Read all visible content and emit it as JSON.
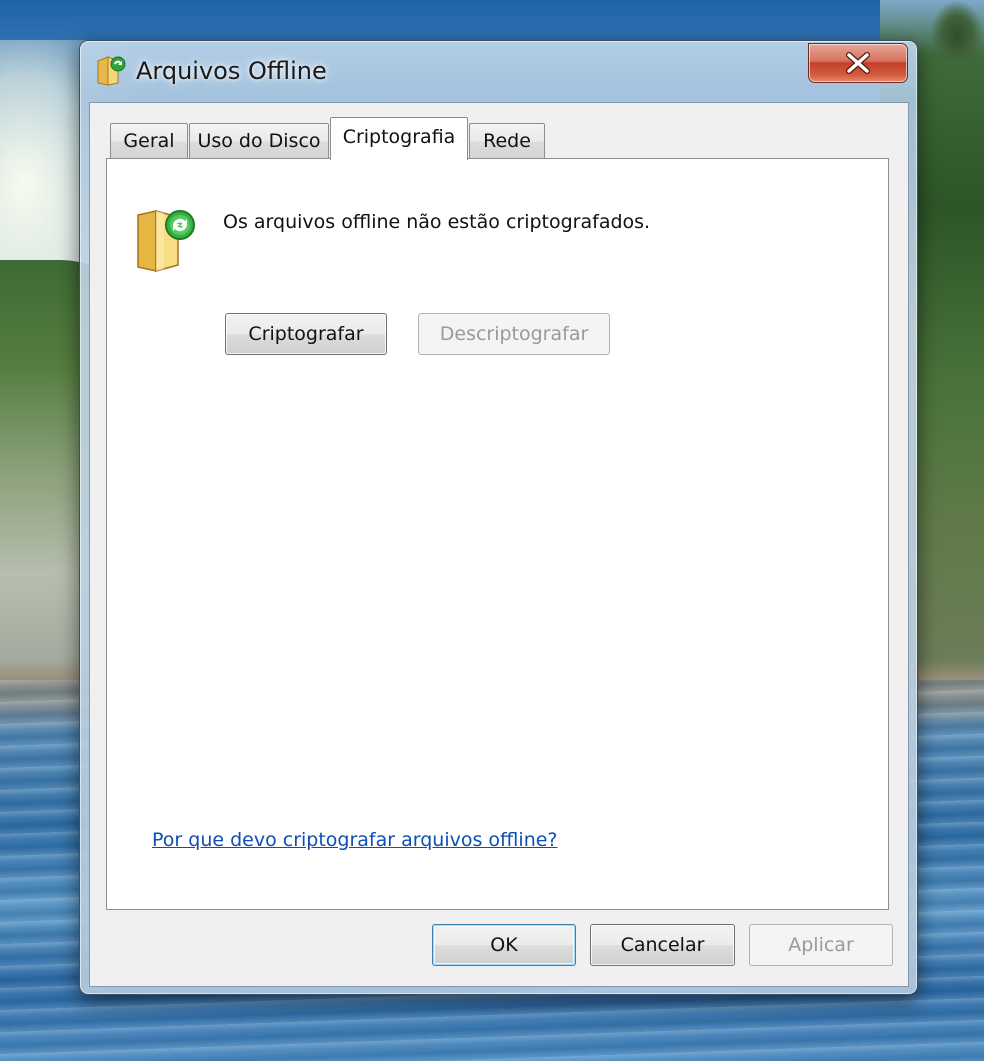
{
  "window": {
    "title": "Arquivos Offline"
  },
  "tabs": [
    {
      "label": "Geral"
    },
    {
      "label": "Uso do Disco"
    },
    {
      "label": "Criptografia"
    },
    {
      "label": "Rede"
    }
  ],
  "active_tab": "Criptografia",
  "encryption": {
    "status_text": "Os arquivos offline não estão criptografados.",
    "encrypt_label": "Criptografar",
    "decrypt_label": "Descriptografar",
    "help_link": "Por que devo criptografar arquivos offline?"
  },
  "footer": {
    "ok_label": "OK",
    "cancel_label": "Cancelar",
    "apply_label": "Aplicar"
  },
  "icons": {
    "title": "offline-files-folder-icon",
    "status": "offline-folder-sync-icon",
    "close": "close-icon"
  },
  "colors": {
    "link": "#0d4fb5",
    "close_button": "#c2402a",
    "default_button_border": "#3c7fb1"
  }
}
